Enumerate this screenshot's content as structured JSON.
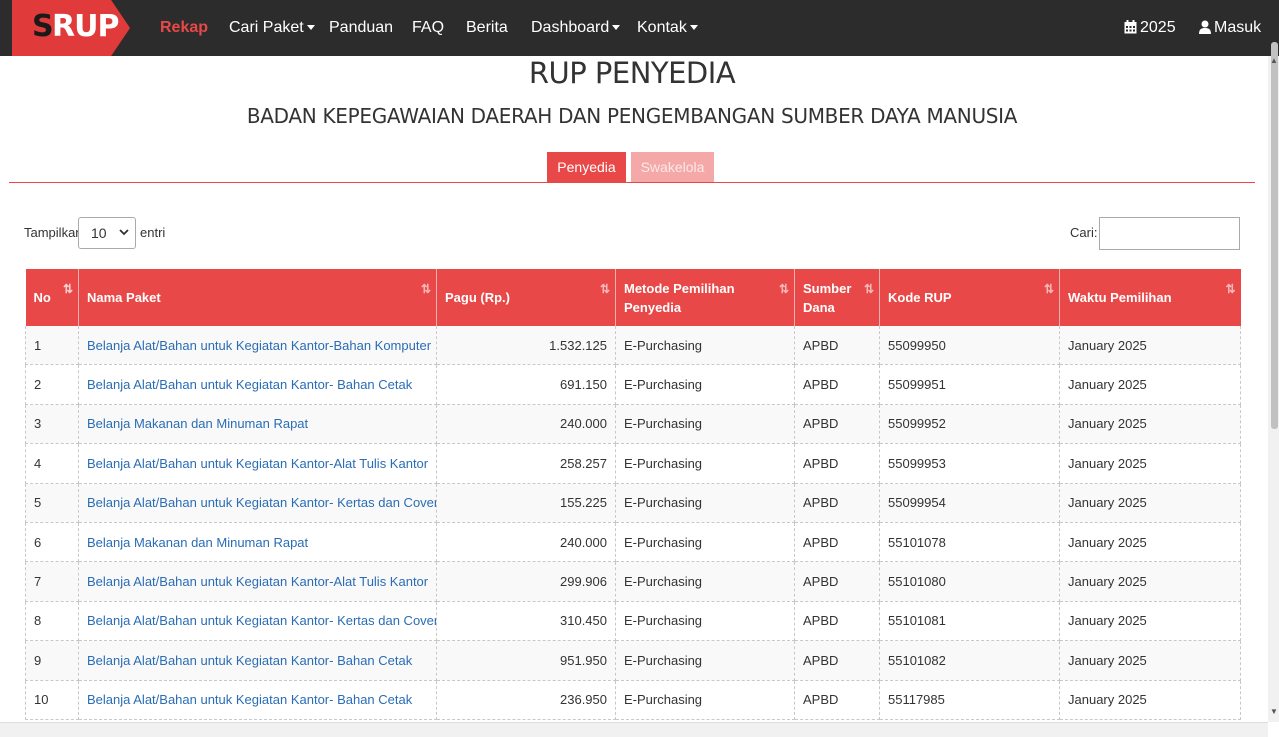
{
  "navbar": {
    "logo_s": "S",
    "logo_rup": "RUP",
    "items": [
      {
        "label": "Rekap",
        "active": true,
        "dropdown": false
      },
      {
        "label": "Cari Paket",
        "active": false,
        "dropdown": true
      },
      {
        "label": "Panduan",
        "active": false,
        "dropdown": false
      },
      {
        "label": "FAQ",
        "active": false,
        "dropdown": false
      },
      {
        "label": "Berita",
        "active": false,
        "dropdown": false
      },
      {
        "label": "Dashboard",
        "active": false,
        "dropdown": true
      },
      {
        "label": "Kontak",
        "active": false,
        "dropdown": true
      }
    ],
    "year": "2025",
    "login": "Masuk",
    "accent": "#e94848"
  },
  "page": {
    "title": "RUP PENYEDIA",
    "subtitle": "BADAN KEPEGAWAIAN DAERAH DAN PENGEMBANGAN SUMBER DAYA MANUSIA"
  },
  "tabs": [
    {
      "label": "Penyedia",
      "active": true
    },
    {
      "label": "Swakelola",
      "active": false
    }
  ],
  "controls": {
    "show_label": "Tampilkan",
    "show_value": "10",
    "entries_label": "entri",
    "search_label": "Cari:",
    "search_value": ""
  },
  "table": {
    "headers": [
      {
        "line1": "No",
        "line2": ""
      },
      {
        "line1": "Nama Paket",
        "line2": ""
      },
      {
        "line1": "Pagu (Rp.)",
        "line2": ""
      },
      {
        "line1": "Metode Pemilihan",
        "line2": "Penyedia"
      },
      {
        "line1": "Sumber",
        "line2": "Dana"
      },
      {
        "line1": "Kode RUP",
        "line2": ""
      },
      {
        "line1": "Waktu Pemilihan",
        "line2": ""
      }
    ],
    "rows": [
      {
        "no": "1",
        "nama": "Belanja Alat/Bahan untuk Kegiatan Kantor-Bahan Komputer",
        "pagu": "1.532.125",
        "metode": "E-Purchasing",
        "dana": "APBD",
        "kode": "55099950",
        "waktu": "January 2025"
      },
      {
        "no": "2",
        "nama": "Belanja Alat/Bahan untuk Kegiatan Kantor- Bahan Cetak",
        "pagu": "691.150",
        "metode": "E-Purchasing",
        "dana": "APBD",
        "kode": "55099951",
        "waktu": "January 2025"
      },
      {
        "no": "3",
        "nama": "Belanja Makanan dan Minuman Rapat",
        "pagu": "240.000",
        "metode": "E-Purchasing",
        "dana": "APBD",
        "kode": "55099952",
        "waktu": "January 2025"
      },
      {
        "no": "4",
        "nama": "Belanja Alat/Bahan untuk Kegiatan Kantor-Alat Tulis Kantor",
        "pagu": "258.257",
        "metode": "E-Purchasing",
        "dana": "APBD",
        "kode": "55099953",
        "waktu": "January 2025"
      },
      {
        "no": "5",
        "nama": "Belanja Alat/Bahan untuk Kegiatan Kantor- Kertas dan Cover",
        "pagu": "155.225",
        "metode": "E-Purchasing",
        "dana": "APBD",
        "kode": "55099954",
        "waktu": "January 2025"
      },
      {
        "no": "6",
        "nama": "Belanja Makanan dan Minuman Rapat",
        "pagu": "240.000",
        "metode": "E-Purchasing",
        "dana": "APBD",
        "kode": "55101078",
        "waktu": "January 2025"
      },
      {
        "no": "7",
        "nama": "Belanja Alat/Bahan untuk Kegiatan Kantor-Alat Tulis Kantor",
        "pagu": "299.906",
        "metode": "E-Purchasing",
        "dana": "APBD",
        "kode": "55101080",
        "waktu": "January 2025"
      },
      {
        "no": "8",
        "nama": "Belanja Alat/Bahan untuk Kegiatan Kantor- Kertas dan Cover",
        "pagu": "310.450",
        "metode": "E-Purchasing",
        "dana": "APBD",
        "kode": "55101081",
        "waktu": "January 2025"
      },
      {
        "no": "9",
        "nama": "Belanja Alat/Bahan untuk Kegiatan Kantor- Bahan Cetak",
        "pagu": "951.950",
        "metode": "E-Purchasing",
        "dana": "APBD",
        "kode": "55101082",
        "waktu": "January 2025"
      },
      {
        "no": "10",
        "nama": "Belanja Alat/Bahan untuk Kegiatan Kantor- Bahan Cetak",
        "pagu": "236.950",
        "metode": "E-Purchasing",
        "dana": "APBD",
        "kode": "55117985",
        "waktu": "January 2025"
      }
    ]
  }
}
